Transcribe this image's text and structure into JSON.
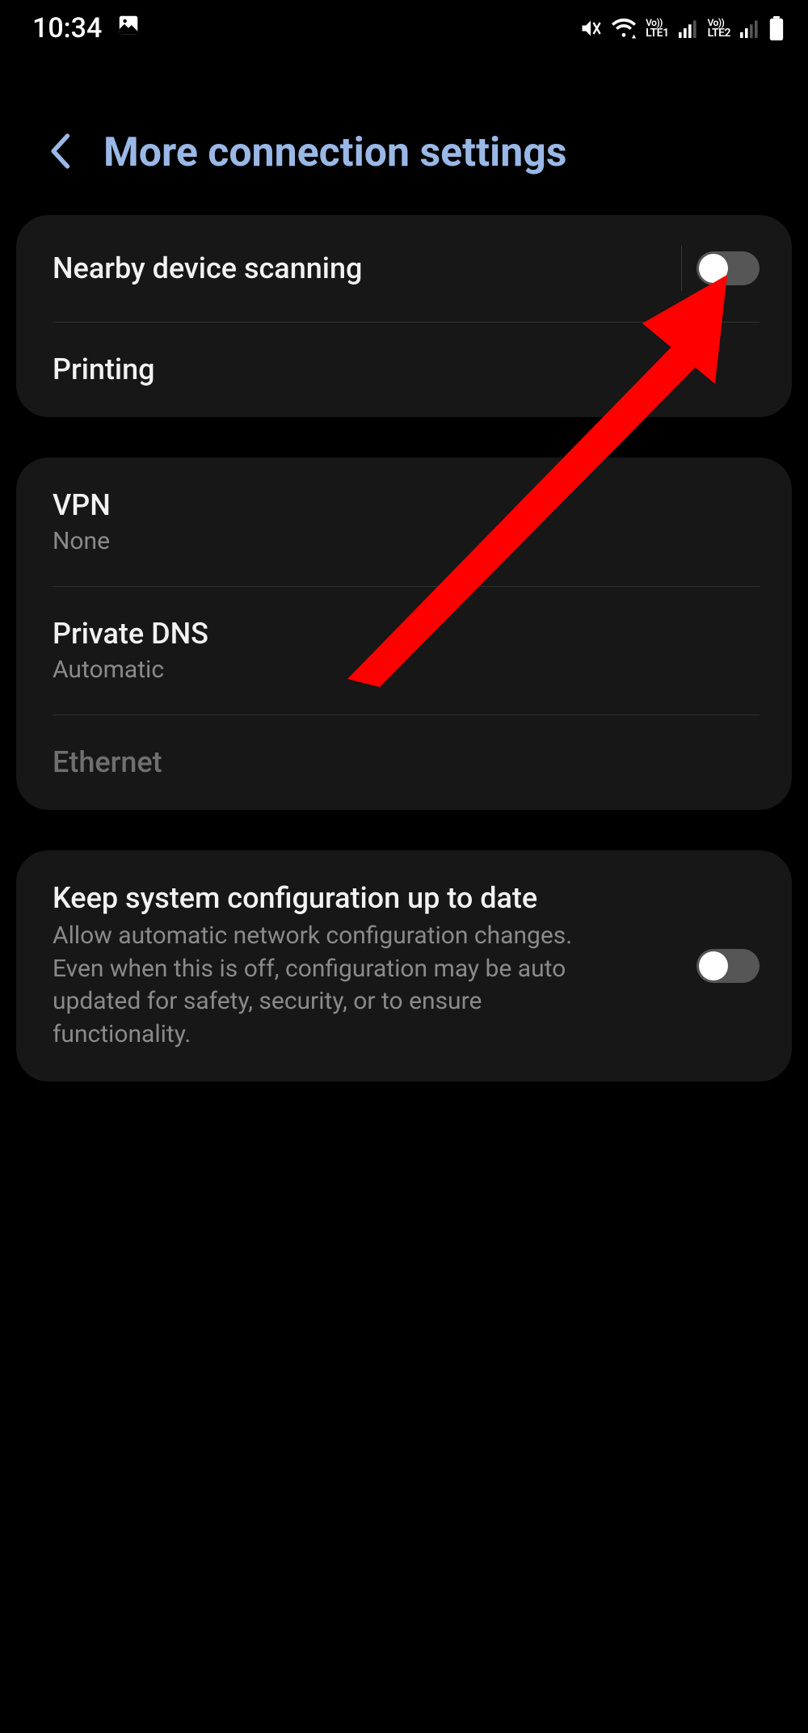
{
  "status_bar": {
    "time": "10:34",
    "sim1_label": "LTE1",
    "sim2_label": "LTE2",
    "vo_label": "Vo))"
  },
  "header": {
    "title": "More connection settings"
  },
  "group1": {
    "nearby_label": "Nearby device scanning",
    "printing_label": "Printing"
  },
  "group2": {
    "vpn_label": "VPN",
    "vpn_sub": "None",
    "dns_label": "Private DNS",
    "dns_sub": "Automatic",
    "ethernet_label": "Ethernet"
  },
  "group3": {
    "keep_label": "Keep system configuration up to date",
    "keep_desc": "Allow automatic network configuration changes. Even when this is off, configuration may be auto updated for safety, security, or to ensure functionality."
  }
}
